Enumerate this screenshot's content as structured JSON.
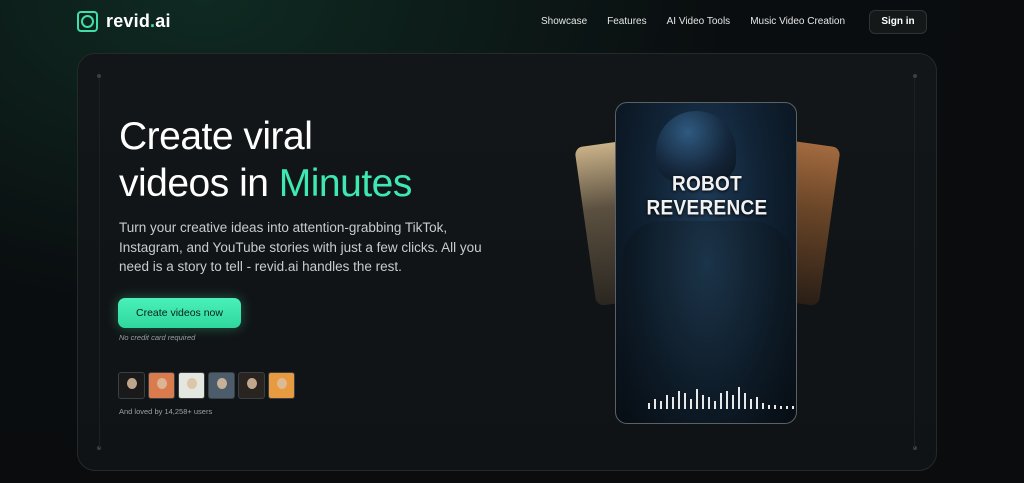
{
  "brand": {
    "name_main": "revid",
    "name_dot": ".",
    "name_suffix": "ai",
    "accent": "#3ee8b0"
  },
  "nav": {
    "links": [
      "Showcase",
      "Features",
      "AI Video Tools",
      "Music Video Creation"
    ],
    "signin_label": "Sign in"
  },
  "hero": {
    "headline_line1": "Create viral",
    "headline_line2_prefix": "videos in",
    "headline_accent": "Minutes",
    "subtitle": "Turn your creative ideas into attention-grabbing TikTok, Instagram, and YouTube stories with just a few clicks. All you need is a story to tell - revid.ai handles the rest.",
    "cta_label": "Create videos now",
    "cta_note": "No credit card required",
    "social_proof": "And loved by 14,258+ users",
    "avatar_count": 6
  },
  "preview": {
    "video_title": "ROBOT REVERENCE"
  }
}
